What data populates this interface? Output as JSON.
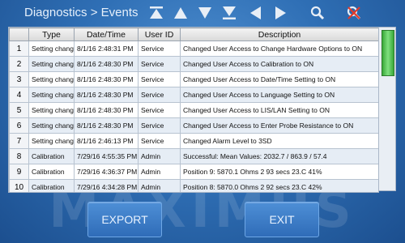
{
  "header": {
    "title": "Diagnostics > Events",
    "nav_icons": [
      "first-page-icon",
      "page-up-icon",
      "page-down-icon",
      "last-page-icon",
      "scroll-left-icon",
      "scroll-right-icon",
      "search-icon",
      "clear-filter-icon"
    ]
  },
  "table": {
    "columns": [
      "Type",
      "Date/Time",
      "User ID",
      "Description"
    ],
    "rows": [
      {
        "idx": "1",
        "type": "Setting change",
        "datetime": "8/1/16 2:48:31 PM",
        "user": "Service",
        "desc": "Changed User Access to Change Hardware Options to ON"
      },
      {
        "idx": "2",
        "type": "Setting change",
        "datetime": "8/1/16 2:48:30 PM",
        "user": "Service",
        "desc": "Changed User Access to Calibration to ON"
      },
      {
        "idx": "3",
        "type": "Setting change",
        "datetime": "8/1/16 2:48:30 PM",
        "user": "Service",
        "desc": "Changed User Access to Date/Time Setting to ON"
      },
      {
        "idx": "4",
        "type": "Setting change",
        "datetime": "8/1/16 2:48:30 PM",
        "user": "Service",
        "desc": "Changed User Access to Language Setting to ON"
      },
      {
        "idx": "5",
        "type": "Setting change",
        "datetime": "8/1/16 2:48:30 PM",
        "user": "Service",
        "desc": "Changed User Access to LIS/LAN Setting to ON"
      },
      {
        "idx": "6",
        "type": "Setting change",
        "datetime": "8/1/16 2:48:30 PM",
        "user": "Service",
        "desc": "Changed User Access to Enter Probe Resistance to ON"
      },
      {
        "idx": "7",
        "type": "Setting change",
        "datetime": "8/1/16 2:46:13 PM",
        "user": "Service",
        "desc": "Changed Alarm Level to 3SD"
      },
      {
        "idx": "8",
        "type": "Calibration",
        "datetime": "7/29/16 4:55:35 PM",
        "user": "Admin",
        "desc": "Successful: Mean Values:  2032.7  /  863.9  /  57.4"
      },
      {
        "idx": "9",
        "type": "Calibration",
        "datetime": "7/29/16 4:36:37 PM",
        "user": "Admin",
        "desc": "Position 9: 5870.1 Ohms 2 93 secs 23.C 41%"
      },
      {
        "idx": "10",
        "type": "Calibration",
        "datetime": "7/29/16 4:34:28 PM",
        "user": "Admin",
        "desc": "Position 8: 5870.0 Ohms 2 92 secs 23.C 42%"
      }
    ]
  },
  "footer": {
    "export_label": "EXPORT",
    "exit_label": "EXIT"
  },
  "watermark": "MAXIMUS",
  "colors": {
    "background": "#2f6fb5",
    "row_alt": "#e6edf5",
    "scroll_thumb": "#38a838"
  }
}
